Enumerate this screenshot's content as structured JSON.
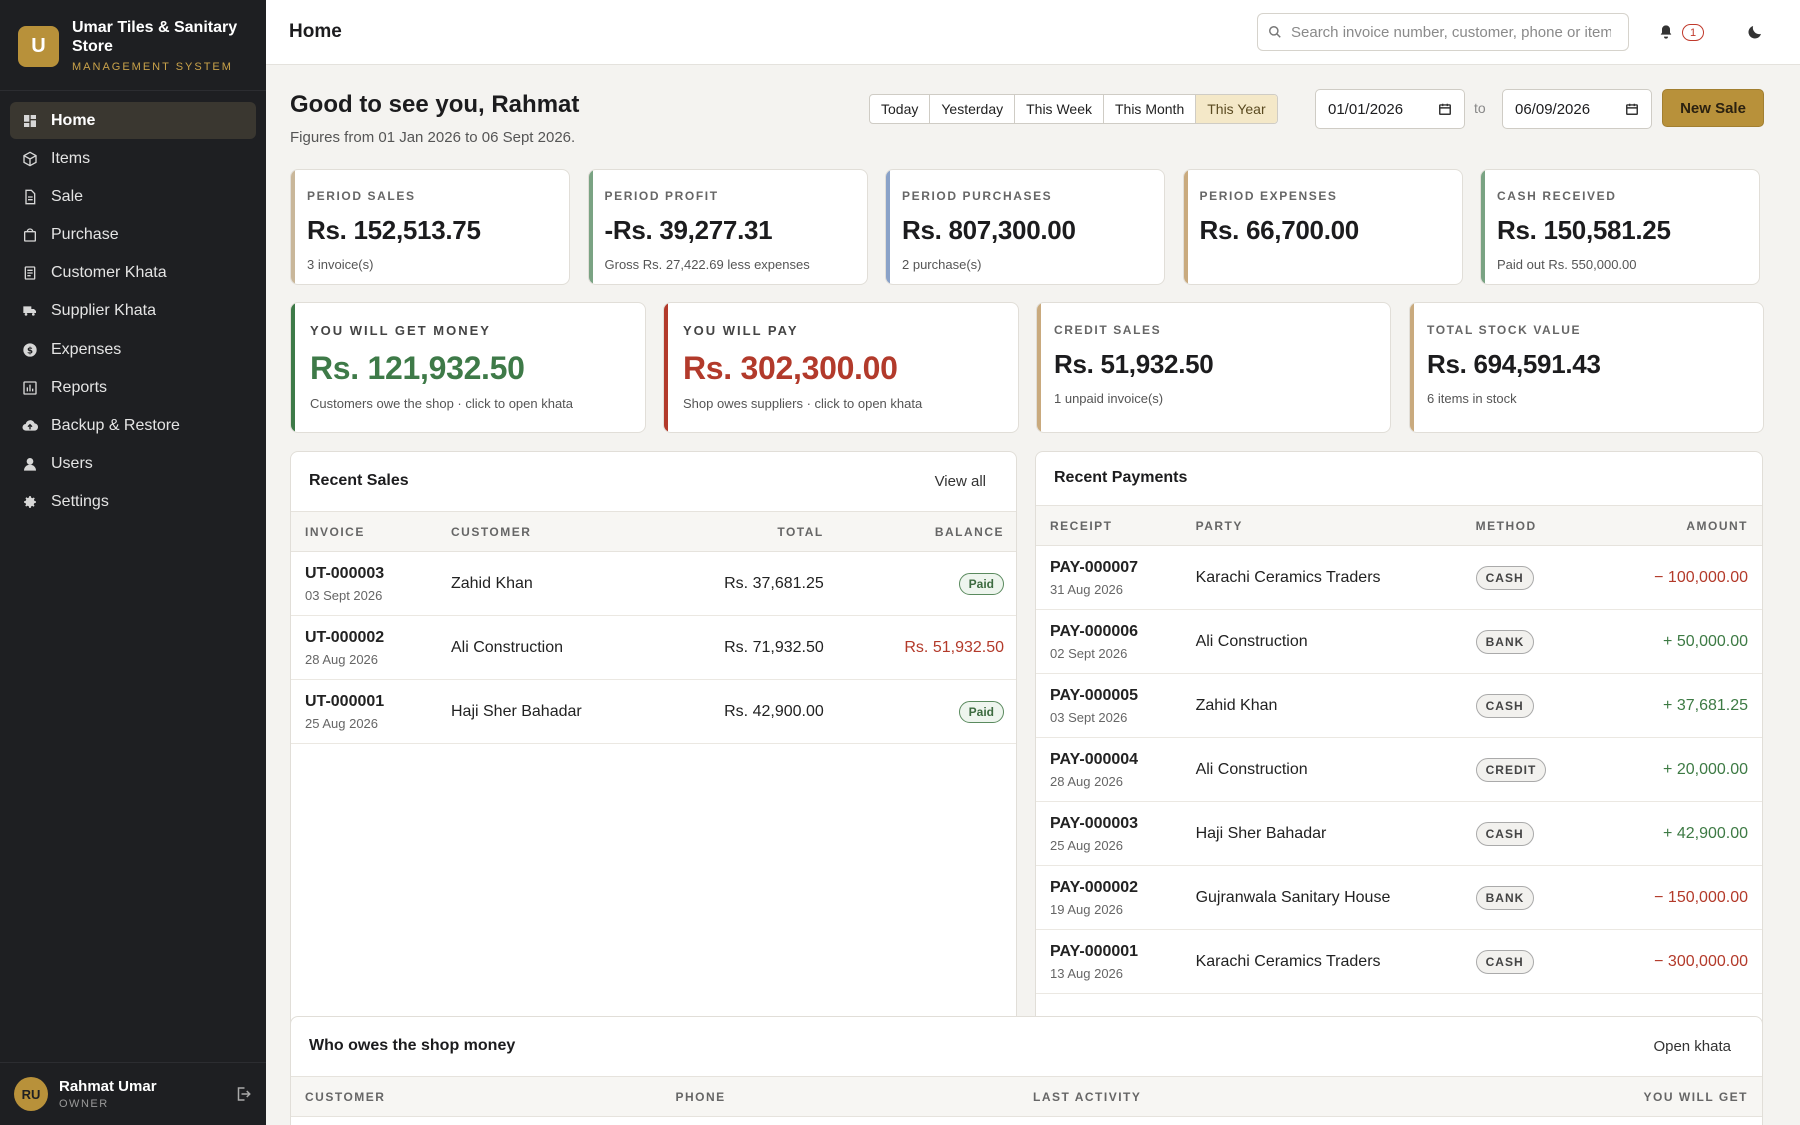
{
  "brand": {
    "logo_letter": "U",
    "name": "Umar Tiles & Sanitary Store",
    "subtitle": "MANAGEMENT SYSTEM"
  },
  "nav": [
    {
      "label": "Home",
      "icon": "dashboard-icon",
      "active": true
    },
    {
      "label": "Items",
      "icon": "box-icon"
    },
    {
      "label": "Sale",
      "icon": "document-icon"
    },
    {
      "label": "Purchase",
      "icon": "bag-icon"
    },
    {
      "label": "Customer Khata",
      "icon": "ledger-icon"
    },
    {
      "label": "Supplier Khata",
      "icon": "truck-icon"
    },
    {
      "label": "Expenses",
      "icon": "dollar-icon"
    },
    {
      "label": "Reports",
      "icon": "report-icon"
    },
    {
      "label": "Backup & Restore",
      "icon": "cloud-icon"
    },
    {
      "label": "Users",
      "icon": "user-icon"
    },
    {
      "label": "Settings",
      "icon": "gear-icon"
    }
  ],
  "user": {
    "initials": "RU",
    "name": "Rahmat Umar",
    "role": "OWNER"
  },
  "topbar": {
    "title": "Home",
    "search_placeholder": "Search invoice number, customer, phone or item",
    "notifications": "1"
  },
  "header": {
    "greeting": "Good to see you, Rahmat",
    "subtitle": "Figures from 01 Jan 2026 to 06 Sept 2026.",
    "ranges": [
      "Today",
      "Yesterday",
      "This Week",
      "This Month",
      "This Year"
    ],
    "active_range": "This Year",
    "date_from": "01/01/2026",
    "to_label": "to",
    "date_to": "06/09/2026",
    "new_sale": "New Sale"
  },
  "stats": [
    {
      "label": "PERIOD SALES",
      "value": "Rs. 152,513.75",
      "sub": "3 invoice(s)",
      "accent": "#c9b79a"
    },
    {
      "label": "PERIOD PROFIT",
      "value": "-Rs. 39,277.31",
      "sub": "Gross Rs. 27,422.69 less expenses",
      "accent": "#7aa383"
    },
    {
      "label": "PERIOD PURCHASES",
      "value": "Rs. 807,300.00",
      "sub": "2 purchase(s)",
      "accent": "#8aa2c8"
    },
    {
      "label": "PERIOD EXPENSES",
      "value": "Rs. 66,700.00",
      "sub": "",
      "accent": "#c9aa7e"
    },
    {
      "label": "CASH RECEIVED",
      "value": "Rs. 150,581.25",
      "sub": "Paid out Rs. 550,000.00",
      "accent": "#7aa383"
    }
  ],
  "big_cards": [
    {
      "label": "YOU WILL GET MONEY",
      "value": "Rs. 121,932.50",
      "sub": "Customers owe the shop · click to open khata",
      "color": "#3e7a48",
      "accent": "#3e7a48"
    },
    {
      "label": "YOU WILL PAY",
      "value": "Rs. 302,300.00",
      "sub": "Shop owes suppliers · click to open khata",
      "color": "#b23a2b",
      "accent": "#b23a2b"
    }
  ],
  "mid_cards": [
    {
      "label": "CREDIT SALES",
      "value": "Rs. 51,932.50",
      "sub": "1 unpaid invoice(s)",
      "accent": "#c9aa7e"
    },
    {
      "label": "TOTAL STOCK VALUE",
      "value": "Rs. 694,591.43",
      "sub": "6 items in stock",
      "accent": "#c9aa7e"
    }
  ],
  "recent_sales": {
    "title": "Recent Sales",
    "link": "View all",
    "columns": [
      "INVOICE",
      "CUSTOMER",
      "TOTAL",
      "BALANCE"
    ],
    "rows": [
      {
        "invoice": "UT-000003",
        "date": "03 Sept 2026",
        "customer": "Zahid Khan",
        "total": "Rs. 37,681.25",
        "balance": "Paid",
        "paid": true
      },
      {
        "invoice": "UT-000002",
        "date": "28 Aug 2026",
        "customer": "Ali Construction",
        "total": "Rs. 71,932.50",
        "balance": "Rs. 51,932.50",
        "paid": false
      },
      {
        "invoice": "UT-000001",
        "date": "25 Aug 2026",
        "customer": "Haji Sher Bahadar",
        "total": "Rs. 42,900.00",
        "balance": "Paid",
        "paid": true
      }
    ]
  },
  "recent_payments": {
    "title": "Recent Payments",
    "columns": [
      "RECEIPT",
      "PARTY",
      "METHOD",
      "AMOUNT"
    ],
    "rows": [
      {
        "receipt": "PAY-000007",
        "date": "31 Aug 2026",
        "party": "Karachi Ceramics Traders",
        "method": "CASH",
        "amount": "− 100,000.00",
        "dir": "out"
      },
      {
        "receipt": "PAY-000006",
        "date": "02 Sept 2026",
        "party": "Ali Construction",
        "method": "BANK",
        "amount": "+ 50,000.00",
        "dir": "in"
      },
      {
        "receipt": "PAY-000005",
        "date": "03 Sept 2026",
        "party": "Zahid Khan",
        "method": "CASH",
        "amount": "+ 37,681.25",
        "dir": "in"
      },
      {
        "receipt": "PAY-000004",
        "date": "28 Aug 2026",
        "party": "Ali Construction",
        "method": "CREDIT",
        "amount": "+ 20,000.00",
        "dir": "in"
      },
      {
        "receipt": "PAY-000003",
        "date": "25 Aug 2026",
        "party": "Haji Sher Bahadar",
        "method": "CASH",
        "amount": "+ 42,900.00",
        "dir": "in"
      },
      {
        "receipt": "PAY-000002",
        "date": "19 Aug 2026",
        "party": "Gujranwala Sanitary House",
        "method": "BANK",
        "amount": "− 150,000.00",
        "dir": "out"
      },
      {
        "receipt": "PAY-000001",
        "date": "13 Aug 2026",
        "party": "Karachi Ceramics Traders",
        "method": "CASH",
        "amount": "− 300,000.00",
        "dir": "out"
      }
    ]
  },
  "owes": {
    "title": "Who owes the shop money",
    "link": "Open khata",
    "columns": [
      "CUSTOMER",
      "PHONE",
      "LAST ACTIVITY",
      "YOU WILL GET"
    ]
  }
}
